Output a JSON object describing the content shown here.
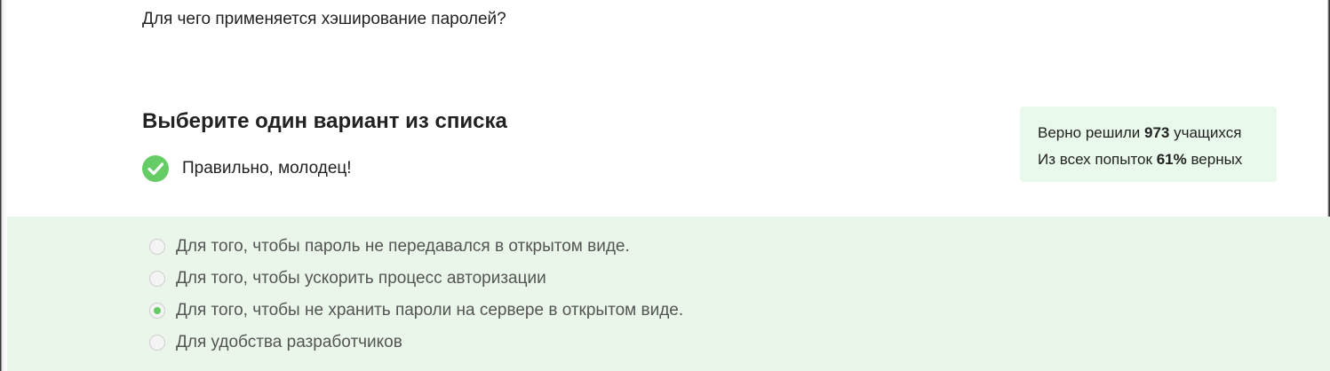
{
  "question": {
    "text": "Для чего применяется хэширование паролей?"
  },
  "section": {
    "title": "Выберите один вариант из списка"
  },
  "feedback": {
    "icon": "check-circle-icon",
    "text": "Правильно, молодец!",
    "color": "#66cc66"
  },
  "stats": {
    "line1_prefix": "Верно решили",
    "solved_count": "973",
    "line1_suffix": "учащихся",
    "line2_prefix": "Из всех попыток",
    "success_rate": "61%",
    "line2_suffix": "верных",
    "background": "#e9f9eb"
  },
  "options": {
    "background": "#e9f6e9",
    "selected_index": 2,
    "items": [
      {
        "label": "Для того, чтобы пароль не передавался в открытом виде."
      },
      {
        "label": "Для того, чтобы ускорить процесс авторизации"
      },
      {
        "label": "Для того, чтобы не хранить пароли на сервере в открытом виде."
      },
      {
        "label": "Для удобства разработчиков"
      }
    ]
  }
}
